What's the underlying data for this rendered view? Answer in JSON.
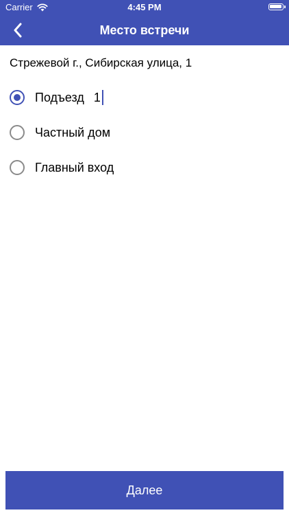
{
  "status_bar": {
    "carrier": "Carrier",
    "time": "4:45 PM"
  },
  "header": {
    "title": "Место встречи"
  },
  "address": "Стрежевой г., Сибирская улица, 1",
  "options": [
    {
      "label": "Подъезд",
      "selected": true,
      "input_value": "1"
    },
    {
      "label": "Частный дом",
      "selected": false
    },
    {
      "label": "Главный вход",
      "selected": false
    }
  ],
  "footer": {
    "next_label": "Далее"
  },
  "colors": {
    "accent": "#4051B5"
  }
}
